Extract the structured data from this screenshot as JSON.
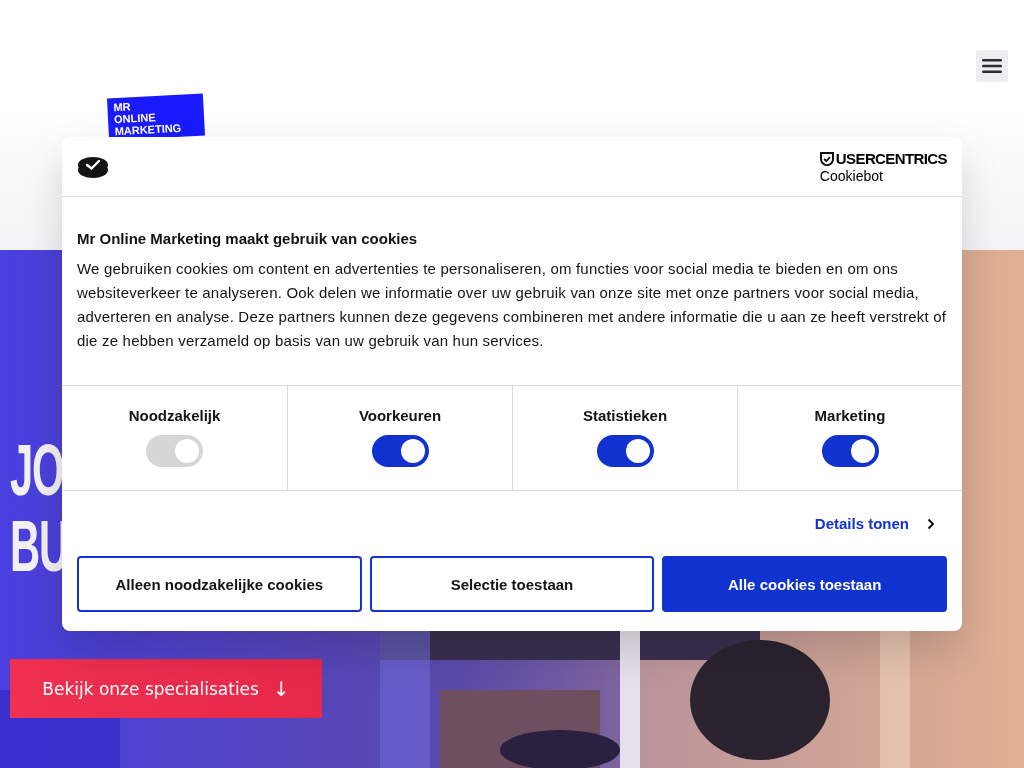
{
  "header": {
    "logo": [
      "MR",
      "ONLINE",
      "MARKETING"
    ]
  },
  "hero": {
    "headline": [
      "JO",
      "BU"
    ],
    "cta": {
      "label": "Bekijk onze specialisaties",
      "arrow": "↓"
    }
  },
  "cookie_dialog": {
    "brand": {
      "name": "USERCENTRICS",
      "product": "Cookiebot"
    },
    "title": "Mr Online Marketing maakt gebruik van cookies",
    "body": "We gebruiken cookies om content en advertenties te personaliseren, om functies voor social media te bieden en om ons websiteverkeer te analyseren. Ook delen we informatie over uw gebruik van onze site met onze partners voor social media, adverteren en analyse. Deze partners kunnen deze gegevens combineren met andere informatie die u aan ze heeft verstrekt of die ze hebben verzameld op basis van uw gebruik van hun services.",
    "categories": [
      {
        "label": "Noodzakelijk",
        "checked": true,
        "disabled": true
      },
      {
        "label": "Voorkeuren",
        "checked": true,
        "disabled": false
      },
      {
        "label": "Statistieken",
        "checked": true,
        "disabled": false
      },
      {
        "label": "Marketing",
        "checked": true,
        "disabled": false
      }
    ],
    "details_link": "Details tonen",
    "buttons": [
      {
        "label": "Alleen noodzakelijke cookies",
        "kind": "outline"
      },
      {
        "label": "Selectie toestaan",
        "kind": "outline"
      },
      {
        "label": "Alle cookies toestaan",
        "kind": "primary"
      }
    ]
  }
}
